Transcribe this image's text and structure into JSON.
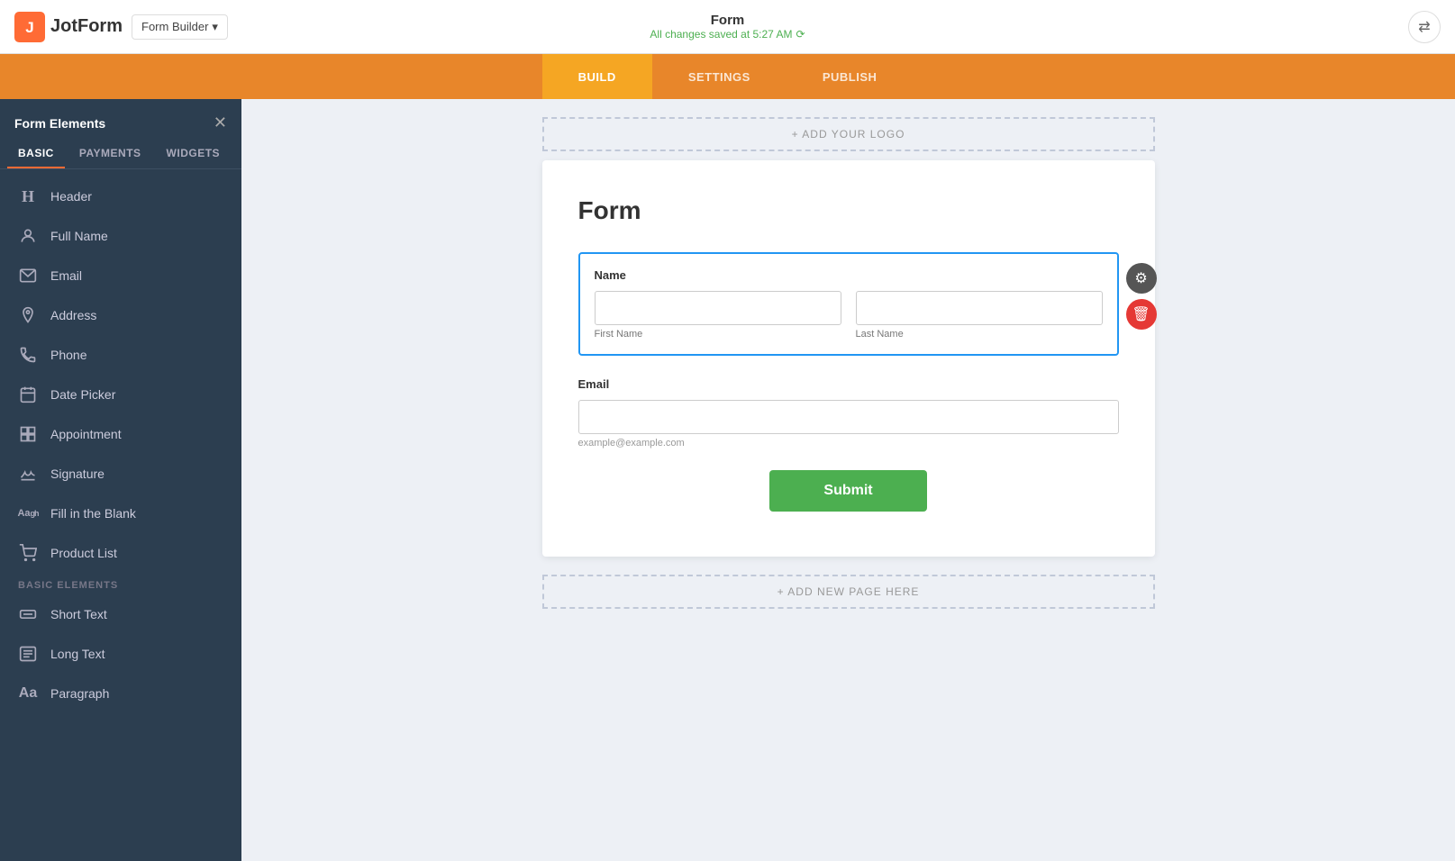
{
  "app": {
    "title": "JotForm",
    "logo_text": "JotForm"
  },
  "top_nav": {
    "form_builder_label": "Form Builder",
    "chevron": "▾",
    "form_title": "Form",
    "saved_status": "All changes saved at 5:27 AM",
    "sync_icon": "⟳",
    "settings_icon": "⇄"
  },
  "tabs": [
    {
      "id": "build",
      "label": "BUILD",
      "active": true
    },
    {
      "id": "settings",
      "label": "SETTINGS",
      "active": false
    },
    {
      "id": "publish",
      "label": "PUBLISH",
      "active": false
    }
  ],
  "sidebar": {
    "title": "Form Elements",
    "close_icon": "✕",
    "tabs": [
      {
        "id": "basic",
        "label": "BASIC",
        "active": true
      },
      {
        "id": "payments",
        "label": "PAYMENTS",
        "active": false
      },
      {
        "id": "widgets",
        "label": "WIDGETS",
        "active": false
      }
    ],
    "items": [
      {
        "id": "header",
        "label": "Header",
        "icon": "H"
      },
      {
        "id": "full-name",
        "label": "Full Name",
        "icon": "👤"
      },
      {
        "id": "email",
        "label": "Email",
        "icon": "✉"
      },
      {
        "id": "address",
        "label": "Address",
        "icon": "📍"
      },
      {
        "id": "phone",
        "label": "Phone",
        "icon": "📞"
      },
      {
        "id": "date-picker",
        "label": "Date Picker",
        "icon": "📅"
      },
      {
        "id": "appointment",
        "label": "Appointment",
        "icon": "⚏"
      },
      {
        "id": "signature",
        "label": "Signature",
        "icon": "✍"
      },
      {
        "id": "fill-in-blank",
        "label": "Fill in the Blank",
        "icon": "Aa"
      },
      {
        "id": "product-list",
        "label": "Product List",
        "icon": "🛒"
      }
    ],
    "section_label": "BASIC ELEMENTS",
    "basic_items": [
      {
        "id": "short-text",
        "label": "Short Text",
        "icon": "⊟"
      },
      {
        "id": "long-text",
        "label": "Long Text",
        "icon": "⊟"
      },
      {
        "id": "paragraph",
        "label": "Paragraph",
        "icon": "Aa"
      }
    ]
  },
  "canvas": {
    "add_logo_label": "+ ADD YOUR LOGO",
    "add_page_label": "+ ADD NEW PAGE HERE",
    "form": {
      "title": "Form",
      "fields": [
        {
          "id": "name-field",
          "label": "Name",
          "type": "name",
          "selected": true,
          "subfields": [
            {
              "placeholder": "",
              "sublabel": "First Name"
            },
            {
              "placeholder": "",
              "sublabel": "Last Name"
            }
          ]
        },
        {
          "id": "email-field",
          "label": "Email",
          "type": "email",
          "placeholder": "",
          "hint": "example@example.com"
        }
      ],
      "submit_label": "Submit"
    }
  },
  "field_actions": {
    "gear_icon": "⚙",
    "delete_icon": "🗑"
  }
}
